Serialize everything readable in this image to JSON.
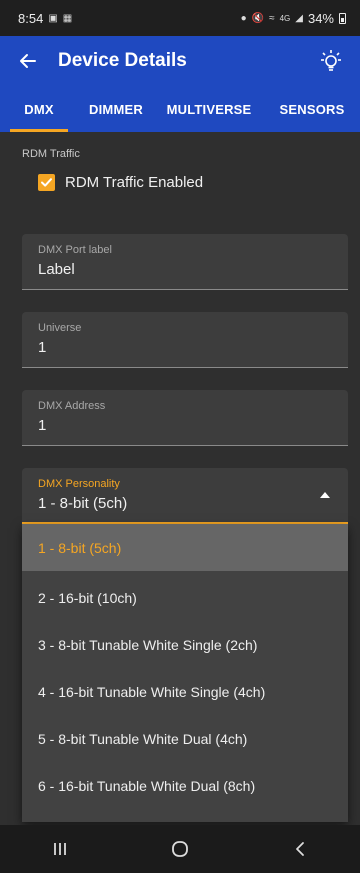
{
  "status_bar": {
    "time": "8:54",
    "battery": "34%",
    "network": "4G",
    "battery_level": 0.34
  },
  "app_bar": {
    "title": "Device Details",
    "back_icon": "arrow-back-icon",
    "action_icon": "lightbulb-icon"
  },
  "tabs": [
    {
      "label": "DMX",
      "active": true
    },
    {
      "label": "DIMMER",
      "active": false
    },
    {
      "label": "MULTIVERSE",
      "active": false
    },
    {
      "label": "SENSORS",
      "active": false
    }
  ],
  "rdm": {
    "section_label": "RDM Traffic",
    "checkbox_label": "RDM Traffic Enabled",
    "checked": true
  },
  "fields": {
    "port_label": {
      "label": "DMX Port label",
      "value": "Label"
    },
    "universe": {
      "label": "Universe",
      "value": "1"
    },
    "address": {
      "label": "DMX Address",
      "value": "1"
    },
    "personality": {
      "label": "DMX Personality",
      "value": "1 - 8-bit (5ch)"
    }
  },
  "personality_options": [
    "1 - 8-bit (5ch)",
    "2 - 16-bit (10ch)",
    "3 - 8-bit Tunable White Single (2ch)",
    "4 - 16-bit Tunable White Single (4ch)",
    "5 - 8-bit Tunable White Dual (4ch)",
    "6 - 16-bit Tunable White Dual (8ch)"
  ],
  "colors": {
    "app_bar": "#1f49c0",
    "accent": "#f5a623",
    "background": "#2f2f2f"
  }
}
